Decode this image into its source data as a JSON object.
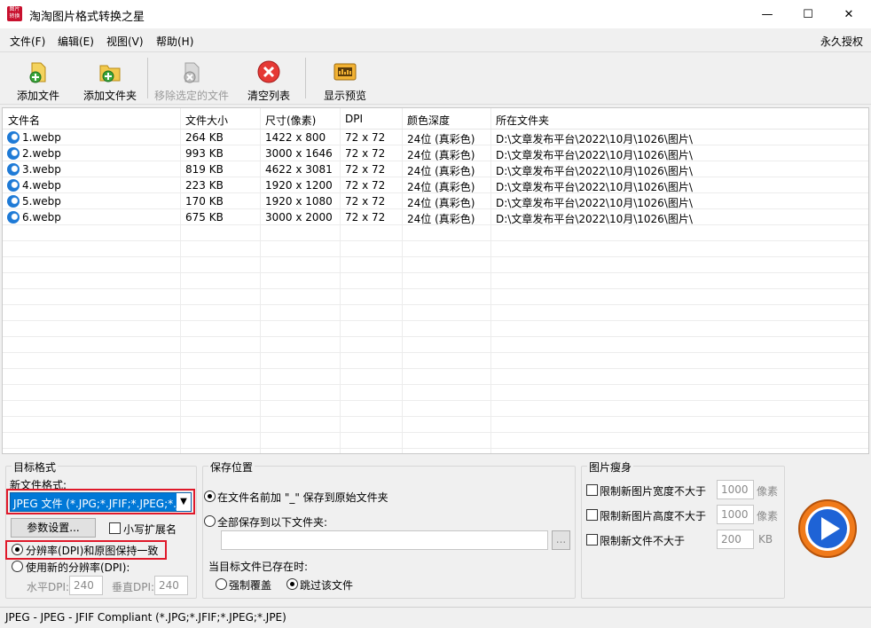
{
  "window": {
    "title": "淘淘图片格式转换之星",
    "logo_text": "图片转换",
    "minimize": "—",
    "maximize": "☐",
    "close": "✕"
  },
  "menu": {
    "items": [
      "文件(F)",
      "编辑(E)",
      "视图(V)",
      "帮助(H)"
    ],
    "license": "永久授权"
  },
  "toolbar": {
    "add_file": "添加文件",
    "add_folder": "添加文件夹",
    "remove_selected": "移除选定的文件",
    "clear_list": "清空列表",
    "show_preview": "显示预览"
  },
  "file_table": {
    "columns": [
      "文件名",
      "文件大小",
      "尺寸(像素)",
      "DPI",
      "颜色深度",
      "所在文件夹"
    ],
    "rows": [
      [
        "1.webp",
        "264 KB",
        "1422 x 800",
        "72 x 72",
        "24位 (真彩色)",
        "D:\\文章发布平台\\2022\\10月\\1026\\图片\\"
      ],
      [
        "2.webp",
        "993 KB",
        "3000 x 1646",
        "72 x 72",
        "24位 (真彩色)",
        "D:\\文章发布平台\\2022\\10月\\1026\\图片\\"
      ],
      [
        "3.webp",
        "819 KB",
        "4622 x 3081",
        "72 x 72",
        "24位 (真彩色)",
        "D:\\文章发布平台\\2022\\10月\\1026\\图片\\"
      ],
      [
        "4.webp",
        "223 KB",
        "1920 x 1200",
        "72 x 72",
        "24位 (真彩色)",
        "D:\\文章发布平台\\2022\\10月\\1026\\图片\\"
      ],
      [
        "5.webp",
        "170 KB",
        "1920 x 1080",
        "72 x 72",
        "24位 (真彩色)",
        "D:\\文章发布平台\\2022\\10月\\1026\\图片\\"
      ],
      [
        "6.webp",
        "675 KB",
        "3000 x 2000",
        "72 x 72",
        "24位 (真彩色)",
        "D:\\文章发布平台\\2022\\10月\\1026\\图片\\"
      ]
    ]
  },
  "target_format": {
    "group_title": "目标格式",
    "new_format_label": "新文件格式:",
    "selected_format": "JPEG 文件 (*.JPG;*.JFIF;*.JPEG;*.JPE)",
    "params_button": "参数设置...",
    "lowercase_ext": "小写扩展名",
    "keep_dpi": "分辨率(DPI)和原图保持一致",
    "use_new_dpi": "使用新的分辨率(DPI):",
    "h_dpi_label": "水平DPI:",
    "h_dpi_value": "240",
    "v_dpi_label": "垂直DPI:",
    "v_dpi_value": "240"
  },
  "save_location": {
    "group_title": "保存位置",
    "option_prefix": "在文件名前加 \"_\" 保存到原始文件夹",
    "option_folder": "全部保存到以下文件夹:",
    "folder_value": "",
    "browse": "...",
    "exists_label": "当目标文件已存在时:",
    "overwrite": "强制覆盖",
    "skip": "跳过该文件"
  },
  "slim": {
    "group_title": "图片瘦身",
    "limit_width": "限制新图片宽度不大于",
    "width_value": "1000",
    "width_unit": "像素",
    "limit_height": "限制新图片高度不大于",
    "height_value": "1000",
    "height_unit": "像素",
    "limit_size": "限制新文件不大于",
    "size_value": "200",
    "size_unit": "KB"
  },
  "status": {
    "text": "JPEG - JPEG - JFIF Compliant (*.JPG;*.JFIF;*.JPEG;*.JPE)"
  },
  "colors": {
    "accent": "#0078d7",
    "highlight_border": "#e0192a",
    "start_orange": "#f07a1a",
    "start_blue": "#1e63d6"
  }
}
